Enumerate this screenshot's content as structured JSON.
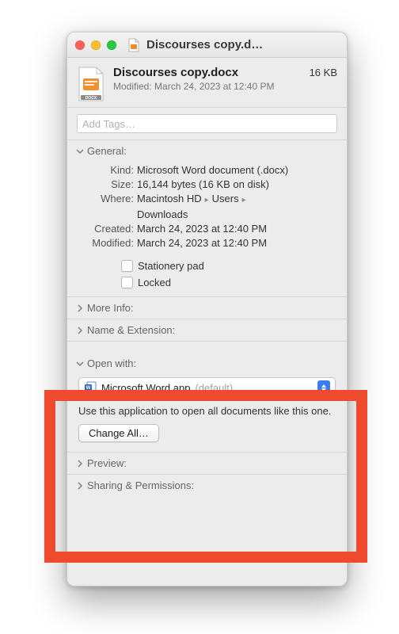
{
  "titlebar": {
    "title": "Discourses copy.d…"
  },
  "header": {
    "filename": "Discourses copy.docx",
    "size": "16 KB",
    "modified_label": "Modified:",
    "modified_value": "March 24, 2023 at 12:40 PM"
  },
  "tags": {
    "placeholder": "Add Tags…"
  },
  "sections": {
    "general": {
      "label": "General:",
      "kind_label": "Kind:",
      "kind_value": "Microsoft Word document (.docx)",
      "size_label": "Size:",
      "size_value": "16,144 bytes (16 KB on disk)",
      "where_label": "Where:",
      "where_parts": [
        "Macintosh HD",
        "Users",
        "Downloads"
      ],
      "created_label": "Created:",
      "created_value": "March 24, 2023 at 12:40 PM",
      "modified_label": "Modified:",
      "modified_value": "March 24, 2023 at 12:40 PM",
      "stationery_label": "Stationery pad",
      "locked_label": "Locked"
    },
    "more_info": {
      "label": "More Info:"
    },
    "name_ext": {
      "label": "Name & Extension:"
    },
    "open_with": {
      "label": "Open with:",
      "app_name": "Microsoft Word.app",
      "default_suffix": "(default)",
      "help_text": "Use this application to open all documents like this one.",
      "change_all": "Change All…"
    },
    "preview": {
      "label": "Preview:"
    },
    "sharing": {
      "label": "Sharing & Permissions:"
    }
  }
}
